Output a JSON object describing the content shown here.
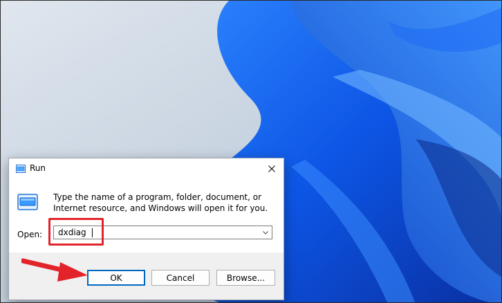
{
  "dialog": {
    "title": "Run",
    "description": "Type the name of a program, folder, document, or Internet resource, and Windows will open it for you.",
    "open_label": "Open:",
    "input_value": "dxdiag",
    "buttons": {
      "ok": "OK",
      "cancel": "Cancel",
      "browse": "Browse..."
    }
  },
  "icons": {
    "title": "run-icon",
    "content": "run-icon",
    "close": "close-icon",
    "dropdown": "chevron-down-icon",
    "annotation": "red-arrow"
  },
  "colors": {
    "highlight": "#e2232a",
    "ok_border": "#0067c0",
    "wallpaper_blue": "#1a5ff2"
  }
}
